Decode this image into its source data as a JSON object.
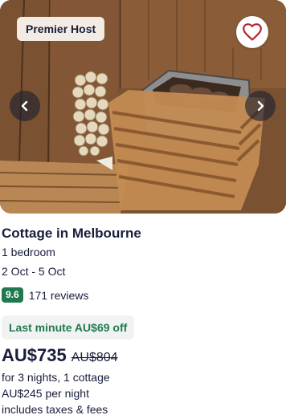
{
  "listing": {
    "badge": "Premier Host",
    "title": "Cottage in Melbourne",
    "bedrooms": "1 bedroom",
    "dates": "2 Oct - 5 Oct",
    "rating": "9.6",
    "reviews": "171 reviews",
    "deal": "Last minute AU$69 off",
    "price": "AU$735",
    "price_original": "AU$804",
    "stay_details": "for 3 nights, 1 cottage",
    "nightly": "AU$245 per night",
    "taxes_note": "includes taxes & fees"
  },
  "icons": {
    "favorite": "heart-icon",
    "previous": "chevron-left-icon",
    "next": "chevron-right-icon"
  },
  "colors": {
    "rating_badge": "#227950",
    "deal_text": "#227950",
    "deal_bg": "#f1f3f2",
    "heart": "#b3262e",
    "text": "#191e3b"
  }
}
